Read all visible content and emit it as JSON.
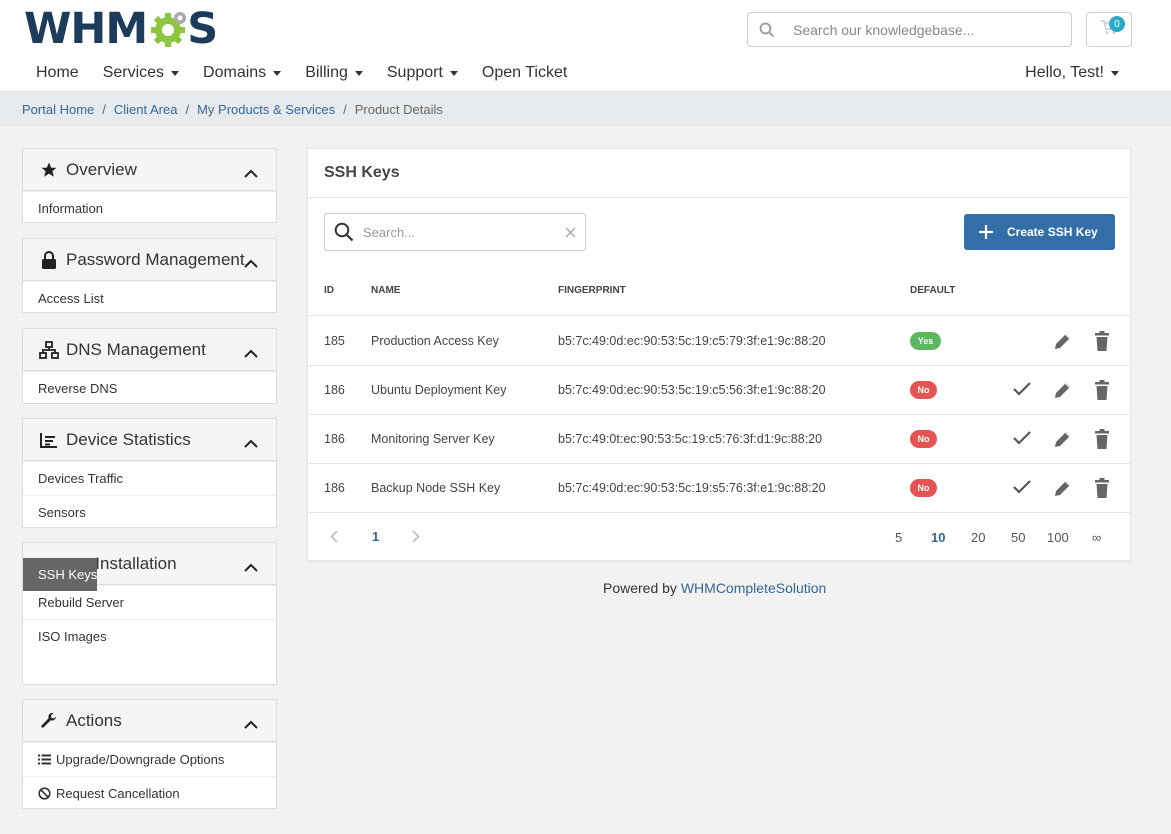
{
  "brand": {
    "logo_text_left": "WHM",
    "logo_text_right": "S"
  },
  "header": {
    "search_placeholder": "Search our knowledgebase...",
    "cart_count": "0",
    "nav": [
      "Home",
      "Services",
      "Domains",
      "Billing",
      "Support",
      "Open Ticket"
    ],
    "nav_has_caret": [
      false,
      true,
      true,
      true,
      true,
      false
    ],
    "user_greeting": "Hello, Test!"
  },
  "breadcrumb": {
    "links": [
      "Portal Home",
      "Client Area",
      "My Products & Services"
    ],
    "current": "Product Details"
  },
  "sidebar": {
    "overview": {
      "title": "Overview",
      "items": [
        "Information"
      ]
    },
    "password": {
      "title": "Password Management",
      "items": [
        "Access List"
      ]
    },
    "dns": {
      "title": "DNS Management",
      "items": [
        "Reverse DNS"
      ]
    },
    "stats": {
      "title": "Device Statistics",
      "items": [
        "Devices Traffic",
        "Sensors"
      ]
    },
    "os": {
      "title": "OS Installation",
      "items": [
        "Rebuild Server",
        "ISO Images",
        "SSH Keys"
      ],
      "active": "SSH Keys"
    },
    "actions": {
      "title": "Actions",
      "items": [
        "Upgrade/Downgrade Options",
        "Request Cancellation"
      ]
    }
  },
  "main": {
    "title": "SSH Keys",
    "search_placeholder": "Search...",
    "create_label": "Create SSH Key",
    "columns": [
      "ID",
      "NAME",
      "FINGERPRINT",
      "DEFAULT"
    ],
    "rows": [
      {
        "id": "185",
        "name": "Production Access Key",
        "fingerprint": "b5:7c:49:0d:ec:90:53:5c:19:c5:79:3f:e1:9c:88:20",
        "default": "Yes"
      },
      {
        "id": "186",
        "name": "Ubuntu Deployment Key",
        "fingerprint": "b5:7c:49:0d:ec:90:53:5c:19:c5:56:3f:e1:9c:88:20",
        "default": "No"
      },
      {
        "id": "186",
        "name": "Monitoring Server Key",
        "fingerprint": "b5:7c:49:0t:ec:90:53:5c:19:c5:76:3f:d1:9c:88:20",
        "default": "No"
      },
      {
        "id": "186",
        "name": "Backup Node SSH Key",
        "fingerprint": "b5:7c:49:0d:ec:90:53:5c:19:s5:76:3f:e1:9c:88:20",
        "default": "No"
      }
    ],
    "pager": {
      "current_page": "1",
      "page_sizes": [
        "5",
        "10",
        "20",
        "50",
        "100",
        "∞"
      ],
      "selected_size": "10"
    }
  },
  "footer": {
    "prefix": "Powered by",
    "link": "WHMCompleteSolution"
  },
  "colors": {
    "accent": "#336ea9",
    "link": "#336699",
    "yes": "#5cb85c",
    "no": "#e55353",
    "active_item": "#666666",
    "logo_green": "#8cc63f"
  }
}
